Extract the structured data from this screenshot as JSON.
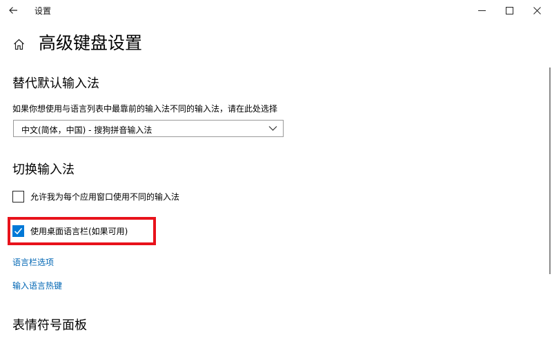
{
  "window": {
    "title": "设置",
    "back_icon": "arrow-left-icon",
    "minimize_icon": "minimize-icon",
    "maximize_icon": "maximize-icon",
    "close_icon": "close-icon"
  },
  "page": {
    "title": "高级键盘设置",
    "home_icon": "home-icon"
  },
  "override_input": {
    "heading": "替代默认输入法",
    "description": "如果你想使用与语言列表中最靠前的输入法不同的输入法，请在此处选择",
    "dropdown_value": "中文(简体，中国) - 搜狗拼音输入法"
  },
  "switch_input": {
    "heading": "切换输入法",
    "checkbox_per_app": {
      "label": "允许我为每个应用窗口使用不同的输入法",
      "checked": false
    },
    "checkbox_language_bar": {
      "label": "使用桌面语言栏(如果可用)",
      "checked": true
    },
    "link_language_bar_options": "语言栏选项",
    "link_input_hotkeys": "输入语言热键"
  },
  "emoji_panel": {
    "heading": "表情符号面板"
  },
  "colors": {
    "accent": "#0078d7",
    "link": "#0066b4",
    "highlight": "#e8121b"
  }
}
